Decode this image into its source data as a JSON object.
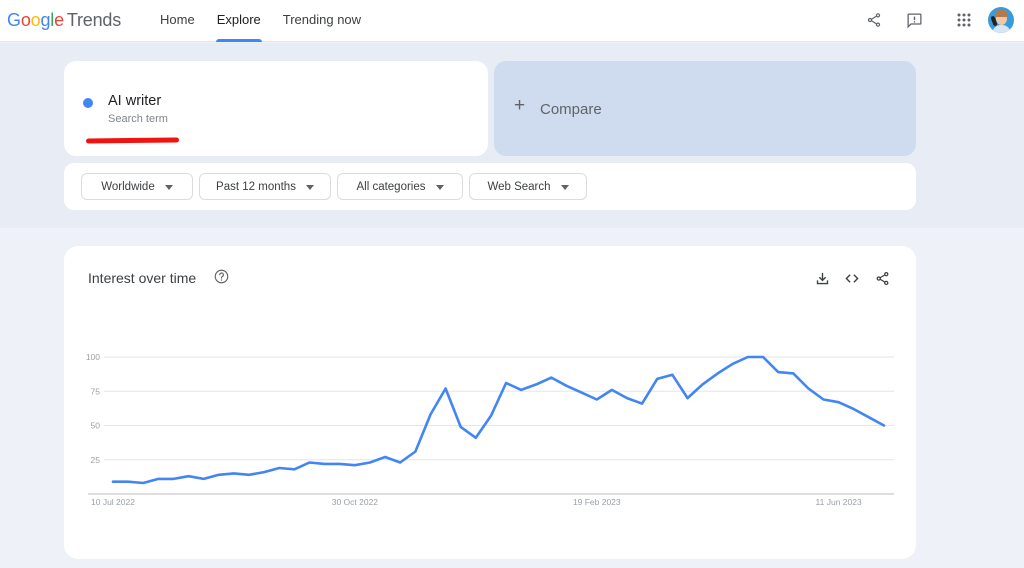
{
  "app": {
    "logo_parts": [
      "G",
      "o",
      "o",
      "g",
      "l",
      "e"
    ],
    "logo_product": "Trends"
  },
  "nav": {
    "items": [
      {
        "label": "Home",
        "active": false
      },
      {
        "label": "Explore",
        "active": true
      },
      {
        "label": "Trending now",
        "active": false
      }
    ]
  },
  "top_icons": [
    "share-icon",
    "feedback-icon",
    "apps-grid-icon",
    "account-avatar"
  ],
  "search_term": {
    "name": "AI writer",
    "type": "Search term",
    "color": "#4285f4",
    "annotation_color": "#f0130f"
  },
  "compare": {
    "label": "Compare",
    "icon": "plus-icon"
  },
  "filters": [
    {
      "label": "Worldwide"
    },
    {
      "label": "Past 12 months"
    },
    {
      "label": "All categories"
    },
    {
      "label": "Web Search"
    }
  ],
  "panel": {
    "title": "Interest over time",
    "actions": [
      "download-icon",
      "embed-code-icon",
      "share-icon"
    ]
  },
  "chart_data": {
    "type": "line",
    "title": "Interest over time",
    "xlabel": "",
    "ylabel": "",
    "ylim": [
      0,
      100
    ],
    "yticks": [
      25,
      50,
      75,
      100
    ],
    "xtick_labels": [
      {
        "label": "10 Jul 2022",
        "index": 0
      },
      {
        "label": "30 Oct 2022",
        "index": 16
      },
      {
        "label": "19 Feb 2023",
        "index": 32
      },
      {
        "label": "11 Jun 2023",
        "index": 48
      }
    ],
    "grid": true,
    "legend": "none",
    "series": [
      {
        "name": "AI writer",
        "color": "#4285f4",
        "values": [
          9,
          9,
          8,
          11,
          11,
          13,
          11,
          14,
          15,
          14,
          16,
          19,
          18,
          23,
          22,
          22,
          21,
          23,
          27,
          23,
          31,
          58,
          77,
          49,
          41,
          57,
          81,
          76,
          80,
          85,
          79,
          74,
          69,
          76,
          70,
          66,
          84,
          87,
          70,
          80,
          88,
          95,
          100,
          100,
          89,
          88,
          77,
          69,
          67,
          62,
          56,
          50
        ]
      }
    ]
  }
}
